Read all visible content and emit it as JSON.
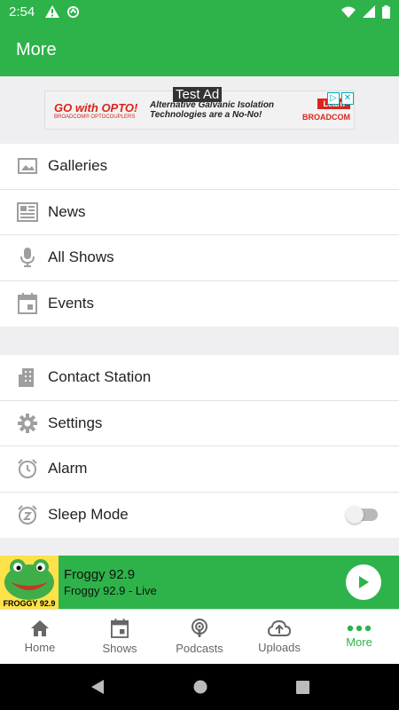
{
  "status_bar": {
    "time": "2:54"
  },
  "app_bar": {
    "title": "More"
  },
  "ad": {
    "label": "Test Ad",
    "brand_headline": "GO with OPTO!",
    "brand_sub": "BROADCOM® OPTOCOUPLERS",
    "copy_line1": "Alternative Galvanic Isolation",
    "copy_line2": "Technologies are a No-No!",
    "learn": "Learn",
    "brand_right": "BROADCOM"
  },
  "menu": {
    "group1": [
      {
        "label": "Galleries",
        "icon": "image-icon"
      },
      {
        "label": "News",
        "icon": "newspaper-icon"
      },
      {
        "label": "All Shows",
        "icon": "microphone-icon"
      },
      {
        "label": "Events",
        "icon": "calendar-icon"
      }
    ],
    "group2": [
      {
        "label": "Contact Station",
        "icon": "building-icon"
      },
      {
        "label": "Settings",
        "icon": "gear-icon"
      },
      {
        "label": "Alarm",
        "icon": "alarm-icon"
      },
      {
        "label": "Sleep Mode",
        "icon": "snooze-icon",
        "toggle_on": false
      }
    ]
  },
  "player": {
    "art_text": "FROGGY 92.9",
    "station": "Froggy 92.9",
    "subtitle": "Froggy 92.9 - Live"
  },
  "bottom_nav": [
    {
      "label": "Home",
      "icon": "home-icon",
      "active": false
    },
    {
      "label": "Shows",
      "icon": "calendar-icon",
      "active": false
    },
    {
      "label": "Podcasts",
      "icon": "podcast-icon",
      "active": false
    },
    {
      "label": "Uploads",
      "icon": "cloud-upload-icon",
      "active": false
    },
    {
      "label": "More",
      "icon": "more-dots-icon",
      "active": true
    }
  ],
  "colors": {
    "accent": "#2db34a",
    "icon_gray": "#9e9e9e"
  }
}
